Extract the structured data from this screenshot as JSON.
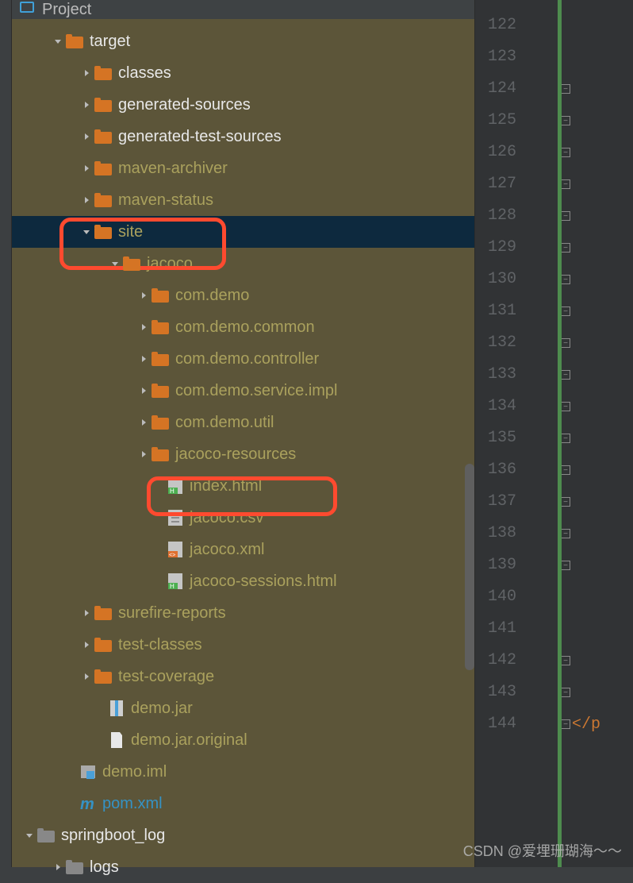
{
  "panel": {
    "title": "Project"
  },
  "tree": [
    {
      "indent": 50,
      "arrow": "down",
      "icon": "folder-orange",
      "label": "target",
      "lclass": "label-white"
    },
    {
      "indent": 86,
      "arrow": "right",
      "icon": "folder-orange",
      "label": "classes",
      "lclass": "label-white"
    },
    {
      "indent": 86,
      "arrow": "right",
      "icon": "folder-orange",
      "label": "generated-sources",
      "lclass": "label-white"
    },
    {
      "indent": 86,
      "arrow": "right",
      "icon": "folder-orange",
      "label": "generated-test-sources",
      "lclass": "label-white"
    },
    {
      "indent": 86,
      "arrow": "right",
      "icon": "folder-orange",
      "label": "maven-archiver",
      "lclass": "label-olive"
    },
    {
      "indent": 86,
      "arrow": "right",
      "icon": "folder-orange",
      "label": "maven-status",
      "lclass": "label-olive"
    },
    {
      "indent": 86,
      "arrow": "down",
      "icon": "folder-orange",
      "label": "site",
      "lclass": "label-olive",
      "selected": true
    },
    {
      "indent": 122,
      "arrow": "down",
      "icon": "folder-orange",
      "label": "jacoco",
      "lclass": "label-olive"
    },
    {
      "indent": 158,
      "arrow": "right",
      "icon": "folder-orange",
      "label": "com.demo",
      "lclass": "label-olive"
    },
    {
      "indent": 158,
      "arrow": "right",
      "icon": "folder-orange",
      "label": "com.demo.common",
      "lclass": "label-olive"
    },
    {
      "indent": 158,
      "arrow": "right",
      "icon": "folder-orange",
      "label": "com.demo.controller",
      "lclass": "label-olive"
    },
    {
      "indent": 158,
      "arrow": "right",
      "icon": "folder-orange",
      "label": "com.demo.service.impl",
      "lclass": "label-olive"
    },
    {
      "indent": 158,
      "arrow": "right",
      "icon": "folder-orange",
      "label": "com.demo.util",
      "lclass": "label-olive"
    },
    {
      "indent": 158,
      "arrow": "right",
      "icon": "folder-orange",
      "label": "jacoco-resources",
      "lclass": "label-olive"
    },
    {
      "indent": 178,
      "arrow": "blank",
      "icon": "html",
      "label": "index.html",
      "lclass": "label-olive"
    },
    {
      "indent": 178,
      "arrow": "blank",
      "icon": "csv",
      "label": "jacoco.csv",
      "lclass": "label-olive"
    },
    {
      "indent": 178,
      "arrow": "blank",
      "icon": "xml",
      "label": "jacoco.xml",
      "lclass": "label-olive"
    },
    {
      "indent": 178,
      "arrow": "blank",
      "icon": "html",
      "label": "jacoco-sessions.html",
      "lclass": "label-olive"
    },
    {
      "indent": 86,
      "arrow": "right",
      "icon": "folder-orange",
      "label": "surefire-reports",
      "lclass": "label-olive"
    },
    {
      "indent": 86,
      "arrow": "right",
      "icon": "folder-orange",
      "label": "test-classes",
      "lclass": "label-olive"
    },
    {
      "indent": 86,
      "arrow": "right",
      "icon": "folder-orange",
      "label": "test-coverage",
      "lclass": "label-olive"
    },
    {
      "indent": 104,
      "arrow": "blank",
      "icon": "jar",
      "label": "demo.jar",
      "lclass": "label-olive"
    },
    {
      "indent": 104,
      "arrow": "blank",
      "icon": "file",
      "label": "demo.jar.original",
      "lclass": "label-olive"
    },
    {
      "indent": 68,
      "arrow": "blank",
      "icon": "iml",
      "label": "demo.iml",
      "lclass": "label-olive"
    },
    {
      "indent": 68,
      "arrow": "blank",
      "icon": "maven",
      "label": "pom.xml",
      "lclass": "label-blue"
    },
    {
      "indent": 14,
      "arrow": "down",
      "icon": "folder-gray",
      "label": "springboot_log",
      "lclass": "label-white"
    },
    {
      "indent": 50,
      "arrow": "right",
      "icon": "folder-gray",
      "label": "logs",
      "lclass": "label-white"
    }
  ],
  "gutter": {
    "start": 122,
    "end": 144,
    "text_frag": "</p"
  },
  "watermark": "CSDN @爱埋珊瑚海～～"
}
